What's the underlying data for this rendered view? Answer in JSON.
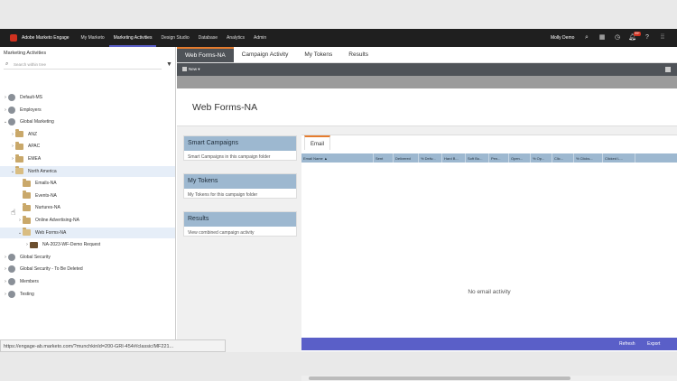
{
  "topnav": {
    "brand": "Adobe Marketo Engage",
    "links": [
      "My Marketo",
      "Marketing Activities",
      "Design Studio",
      "Database",
      "Analytics",
      "Admin"
    ],
    "user": "Molly Demo",
    "badge": "99+",
    "icons": [
      "search-icon",
      "grid-icon",
      "clock-icon",
      "bell-icon",
      "help-icon",
      "apps-icon"
    ]
  },
  "left": {
    "title": "Marketing Activities",
    "search_placeholder": "Search within tree",
    "tree": [
      {
        "label": "Default-MS",
        "type": "globe",
        "level": 0,
        "toggle": ">"
      },
      {
        "label": "Employers",
        "type": "globe",
        "level": 0,
        "toggle": ">"
      },
      {
        "label": "Global Marketing",
        "type": "globe",
        "level": 0,
        "toggle": "v"
      },
      {
        "label": "ANZ",
        "type": "folder",
        "level": 1,
        "toggle": ">"
      },
      {
        "label": "APAC",
        "type": "folder",
        "level": 1,
        "toggle": ">"
      },
      {
        "label": "EMEA",
        "type": "folder",
        "level": 1,
        "toggle": ">"
      },
      {
        "label": "North America",
        "type": "folder-open",
        "level": 1,
        "toggle": "v",
        "highlight": true
      },
      {
        "label": "Emails-NA",
        "type": "folder",
        "level": 2,
        "toggle": ""
      },
      {
        "label": "Events-NA",
        "type": "folder",
        "level": 2,
        "toggle": ""
      },
      {
        "label": "Nurtures-NA",
        "type": "folder",
        "level": 2,
        "toggle": ""
      },
      {
        "label": "Online Advertising-NA",
        "type": "folder",
        "level": 2,
        "toggle": ">"
      },
      {
        "label": "Web Forms-NA",
        "type": "folder-open",
        "level": 2,
        "toggle": "v",
        "highlight": true
      },
      {
        "label": "NA-2023-WF-Demo Request",
        "type": "program",
        "level": 3,
        "toggle": ">"
      },
      {
        "label": "Global Security",
        "type": "globe",
        "level": 0,
        "toggle": ">"
      },
      {
        "label": "Global Security - To Be Deleted",
        "type": "globe",
        "level": 0,
        "toggle": ">"
      },
      {
        "label": "Members",
        "type": "globe",
        "level": 0,
        "toggle": ">"
      },
      {
        "label": "Testing",
        "type": "globe",
        "level": 0,
        "toggle": ">"
      }
    ]
  },
  "status_url": "https://engage-ab.marketo.com/?munchkinId=200-GRI-454#/classic/MF221...",
  "tabs": [
    "Web Forms-NA",
    "Campaign Activity",
    "My Tokens",
    "Results"
  ],
  "toolbar": {
    "new_label": "New"
  },
  "page_title": "Web Forms-NA",
  "panels": [
    {
      "title": "Smart Campaigns",
      "desc": "Smart Campaigns in this campaign folder"
    },
    {
      "title": "My Tokens",
      "desc": "My Tokens for this campaign folder"
    },
    {
      "title": "Results",
      "desc": "View combined campaign activity"
    }
  ],
  "grid": {
    "tab": "Email",
    "columns": [
      "Email Name ▲",
      "Sent",
      "Delivered",
      "% Deliv...",
      "Hard B...",
      "Soft Bo...",
      "Pen...",
      "Open...",
      "% Op...",
      "Clic...",
      "% Clicks...",
      "Clicked L..."
    ],
    "empty": "No email activity",
    "refresh": "Refresh",
    "export": "Export"
  }
}
